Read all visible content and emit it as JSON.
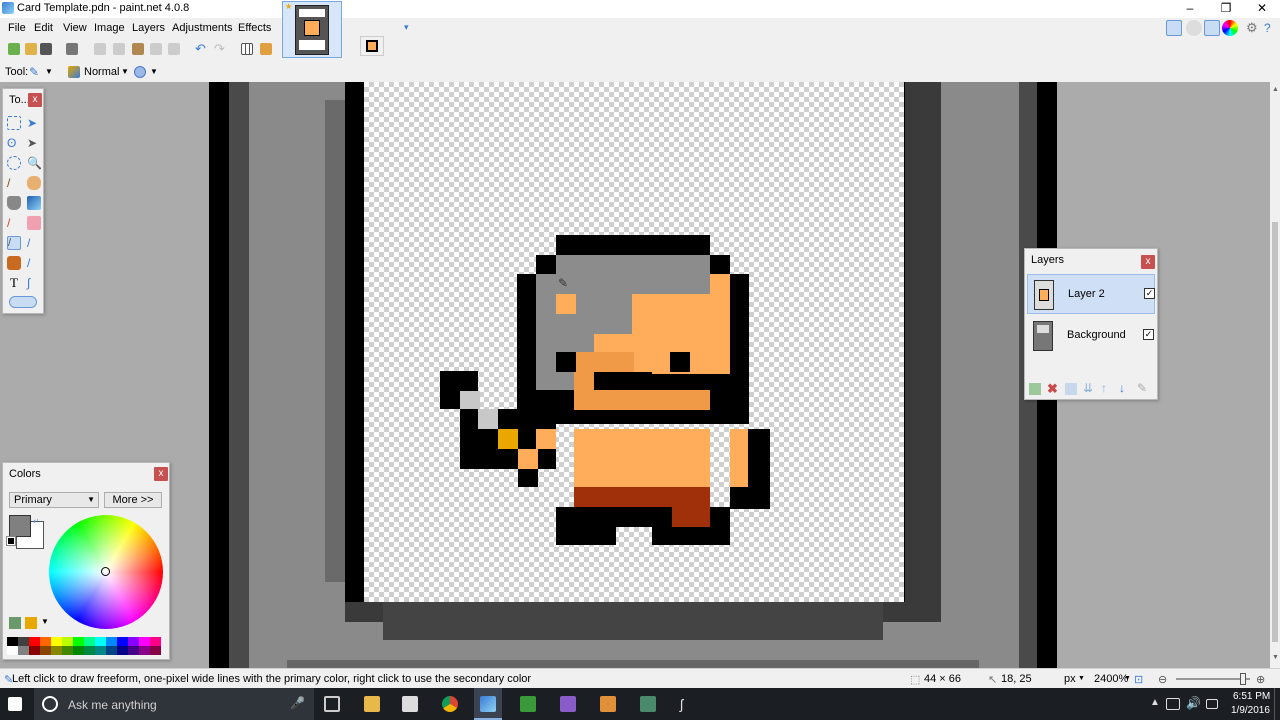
{
  "window": {
    "title": "Card Template.pdn - paint.net 4.0.8",
    "controls": [
      "–",
      "❐",
      "✕"
    ]
  },
  "menu": [
    "File",
    "Edit",
    "View",
    "Image",
    "Layers",
    "Adjustments",
    "Effects"
  ],
  "toolbar": {
    "tool_label": "Tool:",
    "blend_mode": "Normal"
  },
  "tools_panel": {
    "title": "To...",
    "close": "x"
  },
  "colors_panel": {
    "title": "Colors",
    "close": "x",
    "selector": "Primary",
    "more_button": "More >>",
    "primary_color": "#808080",
    "secondary_color": "#ffffff"
  },
  "layers_panel": {
    "title": "Layers",
    "close": "x",
    "layers": [
      {
        "name": "Layer 2",
        "visible": true,
        "selected": true
      },
      {
        "name": "Background",
        "visible": true,
        "selected": false
      }
    ]
  },
  "status": {
    "hint": "Left click to draw freeform, one-pixel wide lines with the primary color, right click to use the secondary color",
    "selection_size": "44 × 66",
    "cursor_pos": "18, 25",
    "units": "px",
    "zoom": "2400%"
  },
  "taskbar": {
    "search_placeholder": "Ask me anything",
    "time": "6:51 PM",
    "date": "1/9/2016"
  },
  "colors": {
    "skin": "#ffad5a",
    "skin_shadow": "#f09a48",
    "hair": "#8c8c8c",
    "outline": "#000000",
    "boots": "#a0300a",
    "gold": "#e8a800",
    "blade": "#c8c8c8"
  }
}
